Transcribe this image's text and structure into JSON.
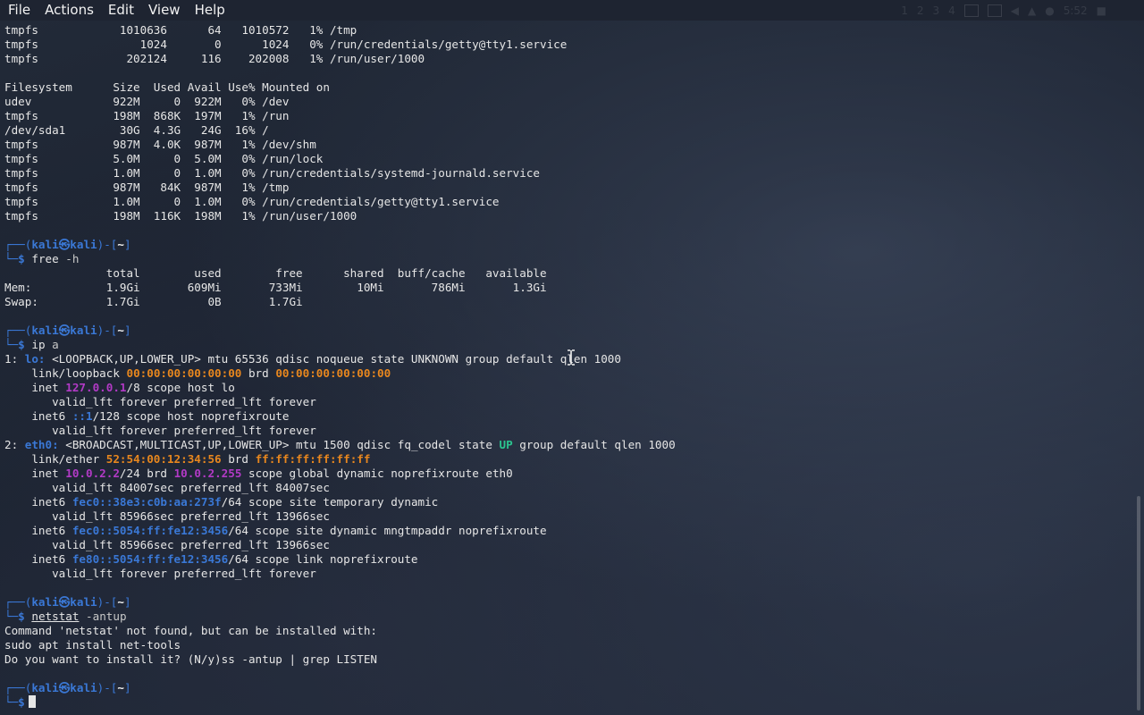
{
  "menu": [
    "File",
    "Actions",
    "Edit",
    "View",
    "Help"
  ],
  "tray": {
    "workspaces": [
      "1",
      "2",
      "3",
      "4"
    ],
    "time": "5:52"
  },
  "colors": {
    "background": "#1c2331",
    "prompt_blue": "#3a78d6",
    "mac_orange": "#e8871e",
    "ipv4_purple": "#b23ac6",
    "state_green": "#2bc38f"
  },
  "terminal": {
    "prompt": {
      "user": "kali",
      "at": "㉿",
      "host": "kali",
      "dir": "~",
      "dollar": "$"
    },
    "df_tail": [
      "tmpfs            1010636      64   1010572   1% /tmp",
      "tmpfs               1024       0      1024   0% /run/credentials/getty@tty1.service",
      "tmpfs             202124     116    202008   1% /run/user/1000"
    ],
    "df_h": [
      "Filesystem      Size  Used Avail Use% Mounted on",
      "udev            922M     0  922M   0% /dev",
      "tmpfs           198M  868K  197M   1% /run",
      "/dev/sda1        30G  4.3G   24G  16% /",
      "tmpfs           987M  4.0K  987M   1% /dev/shm",
      "tmpfs           5.0M     0  5.0M   0% /run/lock",
      "tmpfs           1.0M     0  1.0M   0% /run/credentials/systemd-journald.service",
      "tmpfs           987M   84K  987M   1% /tmp",
      "tmpfs           1.0M     0  1.0M   0% /run/credentials/getty@tty1.service",
      "tmpfs           198M  116K  198M   1% /run/user/1000"
    ],
    "free_cmd": "free",
    "free_arg": "-h",
    "free_out": [
      "               total        used        free      shared  buff/cache   available",
      "Mem:           1.9Gi       609Mi       733Mi        10Mi       786Mi       1.3Gi",
      "Swap:          1.7Gi          0B       1.7Gi"
    ],
    "ip_cmd": "ip",
    "ip_arg": "a",
    "ip": {
      "lo_num": "1: ",
      "lo_name": "lo:",
      "lo_rest": " <LOOPBACK,UP,LOWER_UP> mtu 65536 qdisc noqueue state UNKNOWN group default qlen 1000",
      "lo_link_pre": "    link/loopback ",
      "lo_mac": "00:00:00:00:00:00",
      "lo_brd": " brd ",
      "lo_brd_mac": "00:00:00:00:00:00",
      "lo_inet_pre": "    inet ",
      "lo_inet": "127.0.0.1",
      "lo_inet_rest": "/8 scope host lo",
      "valid_forever": "       valid_lft forever preferred_lft forever",
      "lo_inet6_pre": "    inet6 ",
      "lo_inet6": "::1",
      "lo_inet6_rest": "/128 scope host noprefixroute",
      "eth_num": "2: ",
      "eth_name": "eth0:",
      "eth_rest_a": " <BROADCAST,MULTICAST,UP,LOWER_UP> mtu 1500 qdisc fq_codel state ",
      "eth_state": "UP",
      "eth_rest_b": " group default qlen 1000",
      "eth_link_pre": "    link/ether ",
      "eth_mac": "52:54:00:12:34:56",
      "eth_brd": " brd ",
      "eth_brd_mac": "ff:ff:ff:ff:ff:ff",
      "eth_inet_pre": "    inet ",
      "eth_inet": "10.0.2.2",
      "eth_inet_mid": "/24 brd ",
      "eth_inet_brd": "10.0.2.255",
      "eth_inet_rest": " scope global dynamic noprefixroute eth0",
      "valid_84007": "       valid_lft 84007sec preferred_lft 84007sec",
      "inet6_pre": "    inet6 ",
      "eth_inet6_a": "fec0::38e3:c0b:aa:273f",
      "eth_inet6_a_rest": "/64 scope site temporary dynamic",
      "valid_85966": "       valid_lft 85966sec preferred_lft 13966sec",
      "eth_inet6_b": "fec0::5054:ff:fe12:3456",
      "eth_inet6_b_rest": "/64 scope site dynamic mngtmpaddr noprefixroute",
      "eth_inet6_c": "fe80::5054:ff:fe12:3456",
      "eth_inet6_c_rest": "/64 scope link noprefixroute"
    },
    "netstat_cmd": "netstat",
    "netstat_arg": "-antup",
    "netstat_out": [
      "Command 'netstat' not found, but can be installed with:",
      "sudo apt install net-tools",
      "Do you want to install it? (N/y)ss -antup | grep LISTEN"
    ]
  }
}
